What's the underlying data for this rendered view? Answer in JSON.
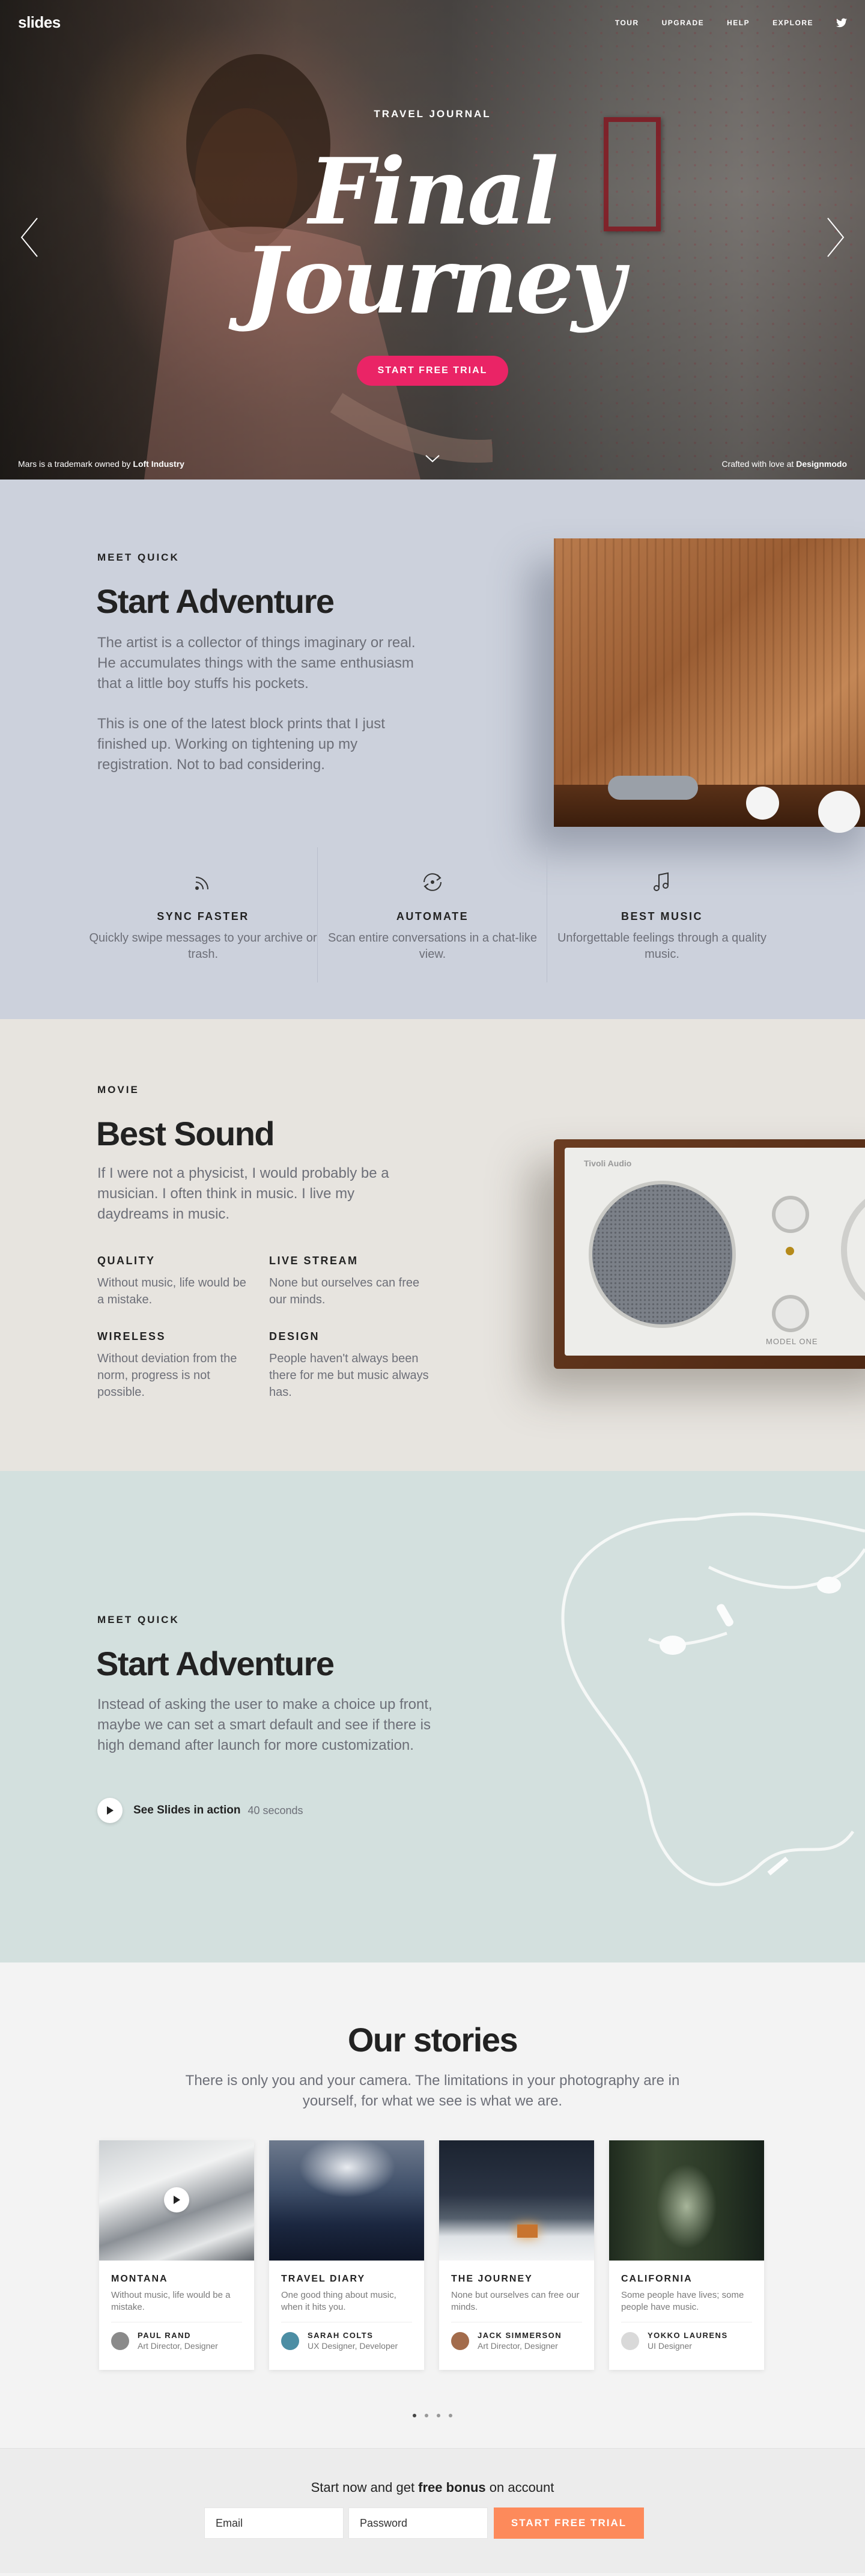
{
  "header": {
    "logo": "slides",
    "nav": [
      "TOUR",
      "UPGRADE",
      "HELP",
      "EXPLORE"
    ],
    "social_icon": "twitter-icon"
  },
  "hero": {
    "eyebrow": "TRAVEL JOURNAL",
    "title_line1": "Final",
    "title_line2": "Journey",
    "cta": "START FREE TRIAL",
    "footer_left_pre": "Mars is a trademark owned by ",
    "footer_left_bold": "Loft Industry",
    "footer_right_pre": "Crafted with love at ",
    "footer_right_bold": "Designmodo",
    "accent": "#ea2466"
  },
  "section_quick": {
    "eyebrow": "MEET QUICK",
    "title": "Start Adventure",
    "para1": "The artist is a collector of things imaginary or real. He accumulates things with the same enthusiasm that a little boy stuffs his pockets.",
    "para2": "This is one of the latest block prints that I just finished up. Working on tightening up my registration. Not to bad considering.",
    "features": [
      {
        "icon": "rss-icon",
        "title": "SYNC FASTER",
        "text": "Quickly swipe messages to your archive or trash."
      },
      {
        "icon": "sync-icon",
        "title": "AUTOMATE",
        "text": "Scan entire conversations in a chat-like view."
      },
      {
        "icon": "music-note-icon",
        "title": "BEST MUSIC",
        "text": "Unforgettable feelings through a quality music."
      }
    ]
  },
  "section_movie": {
    "eyebrow": "MOVIE",
    "title": "Best Sound",
    "para": "If I were not a physicist, I would probably be a musician. I often think in music. I live my daydreams in music.",
    "items": [
      {
        "title": "QUALITY",
        "text": "Without music, life would be a mistake."
      },
      {
        "title": "LIVE STREAM",
        "text": "None but ourselves can free our minds."
      },
      {
        "title": "WIRELESS",
        "text": "Without deviation from the norm, progress is not possible."
      },
      {
        "title": "DESIGN",
        "text": "People haven't always been there for me but music always has."
      }
    ],
    "radio_brand": "Tivoli Audio",
    "radio_model": "MODEL ONE"
  },
  "section_video": {
    "eyebrow": "MEET QUICK",
    "title": "Start Adventure",
    "para": "Instead of asking the user to make a choice up front, maybe we can set a smart default and see if there is high demand after launch for more customization.",
    "link": "See Slides in action",
    "duration": "40 seconds"
  },
  "stories": {
    "title": "Our stories",
    "subtitle": "There is only you and your camera. The limitations in your photography are in yourself, for what we see is what we are.",
    "cards": [
      {
        "title": "MONTANA",
        "text": "Without music, life would be a mistake.",
        "author": "PAUL RAND",
        "role": "Art Director, Designer"
      },
      {
        "title": "TRAVEL DIARY",
        "text": "One good thing about music, when it hits you.",
        "author": "SARAH COLTS",
        "role": "UX Designer, Developer"
      },
      {
        "title": "THE JOURNEY",
        "text": "None but ourselves can free our minds.",
        "author": "JACK SIMMERSON",
        "role": "Art Director, Designer"
      },
      {
        "title": "CALIFORNIA",
        "text": "Some people have lives; some people have music.",
        "author": "YOKKO LAURENS",
        "role": "UI Designer"
      }
    ]
  },
  "signup": {
    "text_pre": "Start now and get ",
    "text_bold": "free bonus",
    "text_post": " on account",
    "email_placeholder": "Email",
    "password_placeholder": "Password",
    "cta": "START FREE TRIAL",
    "accent": "#fd8a5b"
  }
}
